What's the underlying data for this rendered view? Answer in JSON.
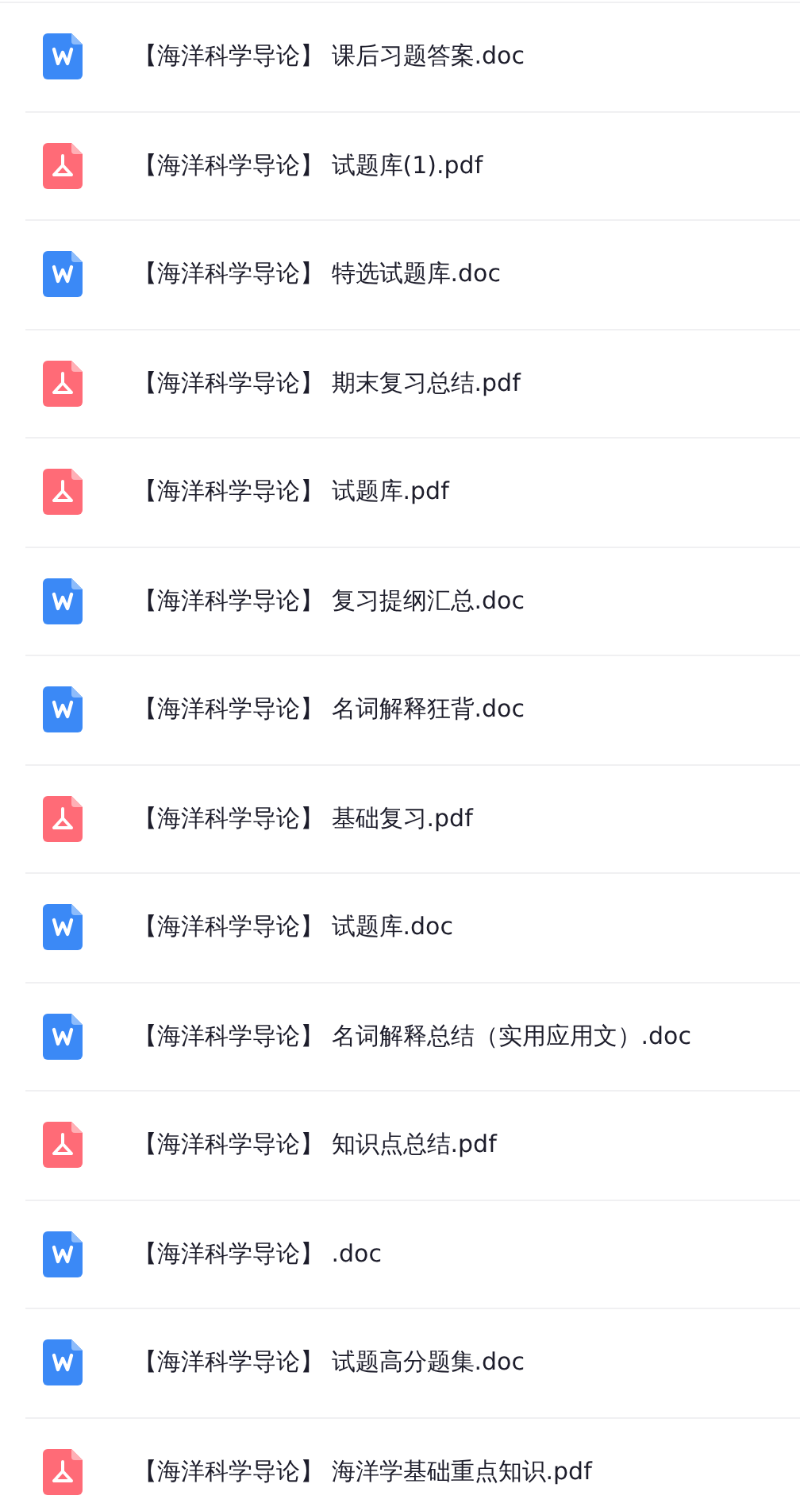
{
  "files": [
    {
      "kind": "doc",
      "name": "【海洋科学导论】 课后习题答案.doc"
    },
    {
      "kind": "pdf",
      "name": "【海洋科学导论】 试题库(1).pdf"
    },
    {
      "kind": "doc",
      "name": "【海洋科学导论】 特选试题库.doc"
    },
    {
      "kind": "pdf",
      "name": "【海洋科学导论】 期末复习总结.pdf"
    },
    {
      "kind": "pdf",
      "name": "【海洋科学导论】 试题库.pdf"
    },
    {
      "kind": "doc",
      "name": "【海洋科学导论】 复习提纲汇总.doc"
    },
    {
      "kind": "doc",
      "name": "【海洋科学导论】 名词解释狂背.doc"
    },
    {
      "kind": "pdf",
      "name": "【海洋科学导论】 基础复习.pdf"
    },
    {
      "kind": "doc",
      "name": "【海洋科学导论】 试题库.doc"
    },
    {
      "kind": "doc",
      "name": "【海洋科学导论】 名词解释总结（实用应用文）.doc"
    },
    {
      "kind": "pdf",
      "name": "【海洋科学导论】 知识点总结.pdf"
    },
    {
      "kind": "doc",
      "name": "【海洋科学导论】 .doc"
    },
    {
      "kind": "doc",
      "name": "【海洋科学导论】 试题高分题集.doc"
    },
    {
      "kind": "pdf",
      "name": "【海洋科学导论】 海洋学基础重点知识.pdf"
    }
  ]
}
